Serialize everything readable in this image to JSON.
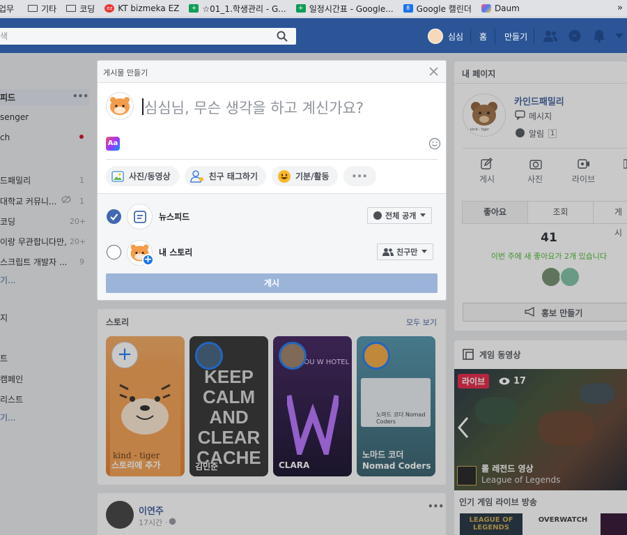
{
  "bookmarks": [
    {
      "label": "업무",
      "icon": "none"
    },
    {
      "label": "기타",
      "icon": "folder"
    },
    {
      "label": "코딩",
      "icon": "folder"
    },
    {
      "label": "KT bizmeka EZ",
      "icon": "ez"
    },
    {
      "label": "☆01_1.학생관리 - G...",
      "icon": "sheet"
    },
    {
      "label": "일정시간표 - Google...",
      "icon": "sheet"
    },
    {
      "label": "Google 캘린더",
      "icon": "cal"
    },
    {
      "label": "Daum",
      "icon": "daum"
    }
  ],
  "bookmarks_more": "»",
  "topbar": {
    "search_placeholder": "색",
    "user_name": "심심",
    "home": "홈",
    "create": "만들기",
    "brand_color": "#2b5597"
  },
  "sidebar": {
    "top_items": [
      {
        "label": "피드",
        "more": "•••"
      },
      {
        "label": "senger"
      },
      {
        "label": "ch",
        "dot": true
      }
    ],
    "groups": [
      {
        "label": "드패밀리",
        "count": "1"
      },
      {
        "label": "대학교 커뮤니...",
        "count": "1"
      },
      {
        "label": "코딩",
        "count": "20+"
      },
      {
        "label": "이랑 무관합니다만,",
        "count": "20+"
      },
      {
        "label": "스크립트 개발자 ...",
        "count": "9"
      },
      {
        "label": "기..."
      }
    ],
    "extra": [
      {
        "label": "지"
      },
      {
        "label": "트"
      },
      {
        "label": "캠페인"
      },
      {
        "label": "리스트"
      },
      {
        "label": "기..."
      }
    ]
  },
  "dialog": {
    "title": "게시물 만들기",
    "placeholder": "심심님, 무슨 생각을 하고 계신가요?",
    "bg_button": "Aa",
    "actions": [
      {
        "label": "사진/동영상"
      },
      {
        "label": "친구 태그하기"
      },
      {
        "label": "기분/활동"
      },
      {
        "label": "•••"
      }
    ],
    "feed_label": "뉴스피드",
    "feed_checked": true,
    "feed_privacy": "전체 공개",
    "story_label": "내 스토리",
    "story_checked": false,
    "story_privacy": "친구만",
    "post_button": "게시"
  },
  "stories": {
    "title": "스토리",
    "see_all": "모두 보기",
    "cards": [
      {
        "name": "스토리에 추가",
        "bg_text": "kind - tiger"
      },
      {
        "name": "김민준",
        "bg_text": "KEEP CALM AND CLEAR CACHE"
      },
      {
        "name": "CLARA",
        "bg_text": "ZHOU W HOTEL"
      },
      {
        "name": "노마드 코더 Nomad Coders",
        "bg_text": "노마드 코더 Nomad Coders"
      }
    ]
  },
  "post": {
    "author": "이연주",
    "time": "17시간 · ",
    "more": "•••"
  },
  "mypage": {
    "title": "내 페이지",
    "name": "카인드패밀리",
    "message": "메시지",
    "alerts": "알림",
    "alerts_count": "1",
    "logo_text": "kind - tiger",
    "actions": [
      {
        "label": "게시"
      },
      {
        "label": "사진"
      },
      {
        "label": "라이브"
      }
    ],
    "tabs": [
      {
        "label": "좋아요"
      },
      {
        "label": "조회"
      },
      {
        "label": "게시"
      }
    ],
    "likes": "41",
    "likes_note": "이번 주에 새 좋아요가 2개 있습니다",
    "promote": "홍보 만들기"
  },
  "game": {
    "title": "게임 동영상",
    "live": "라이브",
    "viewers": "17",
    "video_title": "롤 레전드 영상",
    "video_sub": "League of Legends",
    "section": "인기 게임 라이브 방송",
    "thumbs": [
      "LEAGUE OF LEGENDS",
      "OVERWATCH"
    ]
  }
}
